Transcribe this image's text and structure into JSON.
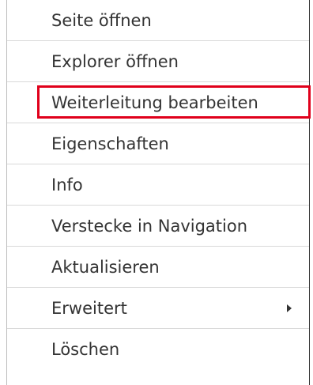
{
  "menu": {
    "items": [
      {
        "label": "Seite öffnen"
      },
      {
        "label": "Explorer öffnen"
      },
      {
        "label": "Weiterleitung bearbeiten"
      },
      {
        "label": "Eigenschaften"
      },
      {
        "label": "Info"
      },
      {
        "label": "Verstecke in Navigation"
      },
      {
        "label": "Aktualisieren"
      },
      {
        "label": "Erweitert",
        "submenu_icon": "chevron-right-icon"
      },
      {
        "label": "Löschen"
      }
    ],
    "highlight_color": "#e0001b"
  }
}
